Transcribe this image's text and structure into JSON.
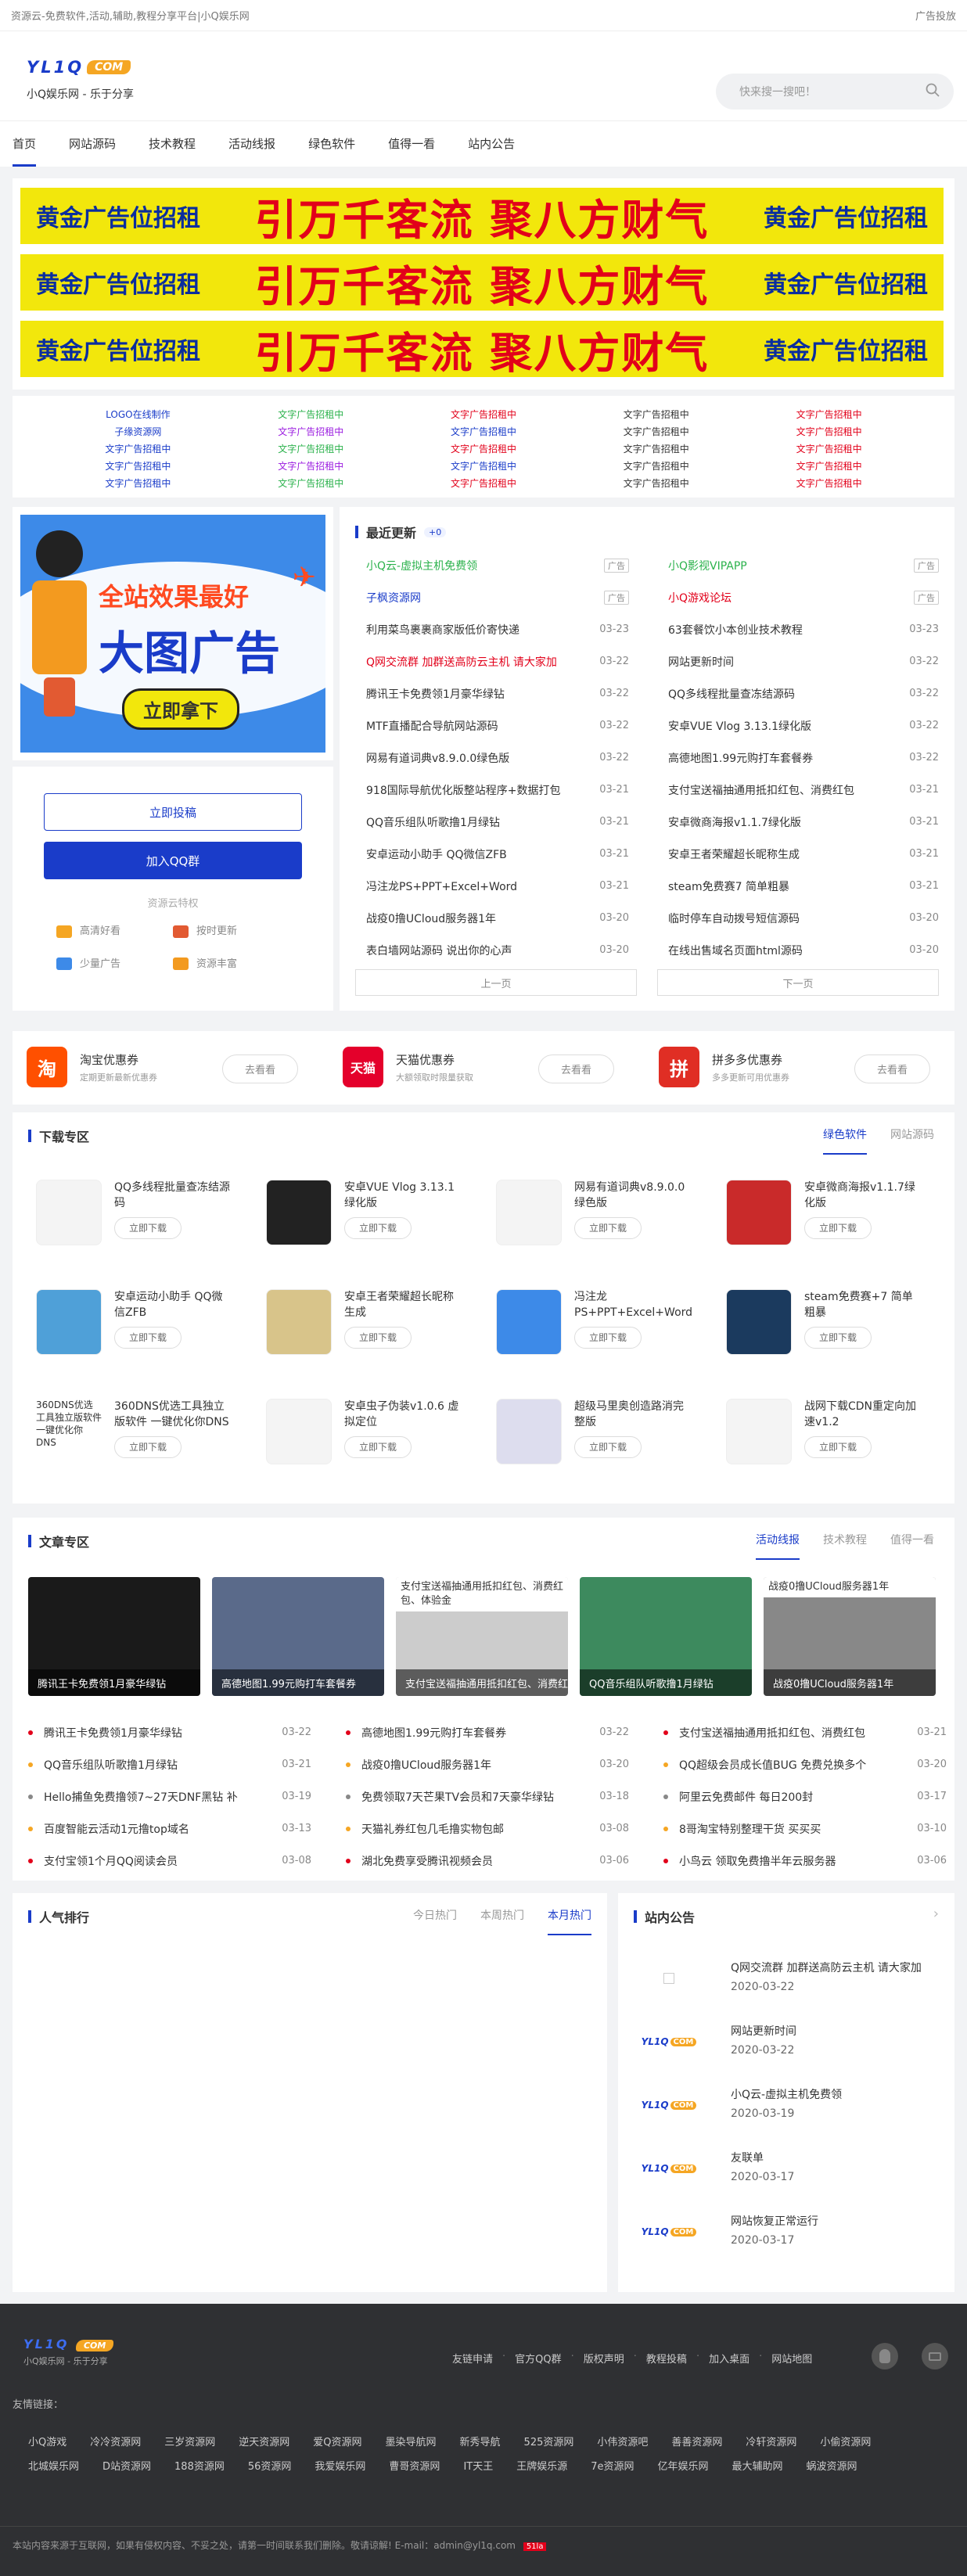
{
  "topbar": {
    "left": "资源云-免费软件,活动,辅助,教程分享平台|小Q娱乐网",
    "right": "广告投放"
  },
  "logo": {
    "main": "YL1Q",
    "badge": "COM",
    "slogan": "小Q娱乐网 - 乐于分享"
  },
  "search": {
    "placeholder": "快来搜一搜吧！"
  },
  "nav": [
    "首页",
    "网站源码",
    "技术教程",
    "活动线报",
    "绿色软件",
    "值得一看",
    "站内公告"
  ],
  "banner": {
    "left": "黄金广告位招租",
    "mid": "引万千客流  聚八方财气",
    "right": "黄金广告位招租"
  },
  "text_links": [
    [
      "LOGO在线制作",
      "文字广告招租中",
      "文字广告招租中",
      "文字广告招租中",
      "文字广告招租中"
    ],
    [
      "子缘资源网",
      "文字广告招租中",
      "文字广告招租中",
      "文字广告招租中",
      "文字广告招租中"
    ],
    [
      "文字广告招租中",
      "文字广告招租中",
      "文字广告招租中",
      "文字广告招租中",
      "文字广告招租中"
    ],
    [
      "文字广告招租中",
      "文字广告招租中",
      "文字广告招租中",
      "文字广告招租中",
      "文字广告招租中"
    ],
    [
      "文字广告招租中",
      "文字广告招租中",
      "文字广告招租中",
      "文字广告招租中",
      "文字广告招租中"
    ]
  ],
  "bigad": {
    "line1": "全站效果最好",
    "line2": "大图广告",
    "btn": "立即拿下"
  },
  "sidebar": {
    "submit": "立即投稿",
    "join": "加入QQ群",
    "feature_title": "资源云特权",
    "features": [
      "高清好看",
      "按时更新",
      "少量广告",
      "资源丰富"
    ]
  },
  "recent": {
    "title": "最近更新",
    "count": "+0",
    "prev": "上一页",
    "next": "下一页",
    "left": [
      [
        "小Q云-虚拟主机免费领",
        "广告"
      ],
      [
        "子枫资源网",
        "广告"
      ],
      [
        "利用菜鸟裹裹商家版低价寄快递",
        "03-23"
      ],
      [
        "Q网交流群 加群送高防云主机 请大家加",
        "03-22"
      ],
      [
        "腾讯王卡免费领1月豪华绿钻",
        "03-22"
      ],
      [
        "MTF直播配合导航网站源码",
        "03-22"
      ],
      [
        "网易有道词典v8.9.0.0绿色版",
        "03-22"
      ],
      [
        "918国际导航优化版整站程序+数据打包",
        "03-21"
      ],
      [
        "QQ音乐组队听歌撸1月绿钻",
        "03-21"
      ],
      [
        "安卓运动小助手 QQ微信ZFB",
        "03-21"
      ],
      [
        "冯注龙PS+PPT+Excel+Word",
        "03-21"
      ],
      [
        "战疫0撸UCloud服务器1年",
        "03-20"
      ],
      [
        "表白墙网站源码 说出你的心声",
        "03-20"
      ]
    ],
    "right": [
      [
        "小Q影视VIPAPP",
        "广告"
      ],
      [
        "小Q游戏论坛",
        "广告"
      ],
      [
        "63套餐饮小本创业技术教程",
        "03-23"
      ],
      [
        "网站更新时间",
        "03-22"
      ],
      [
        "QQ多线程批量查冻结源码",
        "03-22"
      ],
      [
        "安卓VUE Vlog 3.13.1绿化版",
        "03-22"
      ],
      [
        "高德地图1.99元购打车套餐券",
        "03-22"
      ],
      [
        "支付宝送福抽通用抵扣红包、消费红包",
        "03-21"
      ],
      [
        "安卓微商海报v1.1.7绿化版",
        "03-21"
      ],
      [
        "安卓王者荣耀超长昵称生成",
        "03-21"
      ],
      [
        "steam免费赛7 简单粗暴",
        "03-21"
      ],
      [
        "临时停车自动拨号短信源码",
        "03-20"
      ],
      [
        "在线出售域名页面html源码",
        "03-20"
      ]
    ]
  },
  "coupons": [
    {
      "icon": "淘",
      "title": "淘宝优惠券",
      "sub": "定期更新最新优惠券",
      "btn": "去看看",
      "color": "#ff5000"
    },
    {
      "icon": "天猫",
      "title": "天猫优惠券",
      "sub": "大额领取时限量获取",
      "btn": "去看看",
      "color": "#e4002b"
    },
    {
      "icon": "拼",
      "title": "拼多多优惠券",
      "sub": "多多更新可用优惠券",
      "btn": "去看看",
      "color": "#e02e24"
    }
  ],
  "download": {
    "title": "下载专区",
    "tabs": [
      "绿色软件",
      "网站源码"
    ],
    "btn": "立即下载",
    "items": [
      "QQ多线程批量查冻结源码",
      "安卓VUE Vlog 3.13.1绿化版",
      "网易有道词典v8.9.0.0绿色版",
      "安卓微商海报v1.1.7绿化版",
      "安卓运动小助手 QQ微信ZFB",
      "安卓王者荣耀超长昵称生成",
      "冯注龙PS+PPT+Excel+Word",
      "steam免费赛+7 简单粗暴",
      "360DNS优选工具独立版软件 一键优化你DNS",
      "安卓虫子伪装v1.0.6 虚拟定位",
      "超级马里奥创造路消完整版",
      "战网下载CDN重定向加速v1.2"
    ],
    "img_alt": "360DNS优选工具独立版软件 一键优化你DNS"
  },
  "article": {
    "title": "文章专区",
    "tabs": [
      "活动线报",
      "技术教程",
      "值得一看"
    ],
    "cards": [
      "腾讯王卡免费领1月豪华绿钻",
      "高德地图1.99元购打车套餐券",
      "支付宝送福抽通用抵扣红包、消费红包、体验金",
      "QQ音乐组队听歌撸1月绿钻",
      "战疫0撸UCloud服务器1年"
    ],
    "card3_alt": "支付宝送福抽通用抵扣红包、消费红包、体验金",
    "card5_alt": "战疫0撸UCloud服务器1年",
    "cols": [
      [
        [
          "腾讯王卡免费领1月豪华绿钻",
          "03-22"
        ],
        [
          "QQ音乐组队听歌撸1月绿钻",
          "03-21"
        ],
        [
          "Hello捕鱼免费撸领7~27天DNF黑钻 补",
          "03-19"
        ],
        [
          "百度智能云活动1元撸top域名",
          "03-13"
        ],
        [
          "支付宝领1个月QQ阅读会员",
          "03-08"
        ]
      ],
      [
        [
          "高德地图1.99元购打车套餐券",
          "03-22"
        ],
        [
          "战疫0撸UCloud服务器1年",
          "03-20"
        ],
        [
          "免费领取7天芒果TV会员和7天豪华绿钻",
          "03-18"
        ],
        [
          "天猫礼券红包几毛撸实物包邮",
          "03-08"
        ],
        [
          "湖北免费享受腾讯视频会员",
          "03-06"
        ]
      ],
      [
        [
          "支付宝送福抽通用抵扣红包、消费红包",
          "03-21"
        ],
        [
          "QQ超级会员成长值BUG 免费兑换多个",
          "03-20"
        ],
        [
          "阿里云免费邮件 每日200封",
          "03-17"
        ],
        [
          "8哥淘宝特别整理干货 买买买",
          "03-10"
        ],
        [
          "小鸟云 领取免费撸半年云服务器",
          "03-06"
        ]
      ]
    ],
    "dots": [
      "#e2001a",
      "#f5a623",
      "#888",
      "#f5a623",
      "#e2001a"
    ]
  },
  "rank": {
    "title": "人气排行",
    "tabs": [
      "今日热门",
      "本周热门",
      "本月热门"
    ]
  },
  "notice": {
    "title": "站内公告",
    "items": [
      [
        "Q网交流群 加群送高防云主机 请大家加",
        "2020-03-22"
      ],
      [
        "网站更新时间",
        "2020-03-22"
      ],
      [
        "小Q云-虚拟主机免费领",
        "2020-03-19"
      ],
      [
        "友联单",
        "2020-03-17"
      ],
      [
        "网站恢复正常运行",
        "2020-03-17"
      ]
    ],
    "img_alt": ""
  },
  "footer": {
    "links": [
      "友链申请",
      "官方QQ群",
      "版权声明",
      "教程投稿",
      "加入桌面",
      "网站地图"
    ],
    "friend_title": "友情链接：",
    "friends": [
      "小Q游戏",
      "冷冷资源网",
      "三岁资源网",
      "逆天资源网",
      "爱Q资源网",
      "墨染导航网",
      "新秀导航",
      "525资源网",
      "小伟资源吧",
      "善善资源网",
      "冷轩资源网",
      "小偷资源网",
      "北城娱乐网",
      "D站资源网",
      "188资源网",
      "56资源网",
      "我爱娱乐网",
      "曹哥资源网",
      "IT天王",
      "王牌娱乐源",
      "7e资源网",
      "亿年娱乐网",
      "最大辅助网",
      "蜗波资源网"
    ],
    "copyright": "本站内容来源于互联网，如果有侵权内容、不妥之处，请第一时间联系我们删除。敬请谅解! E-mail：admin@yl1q.com"
  }
}
